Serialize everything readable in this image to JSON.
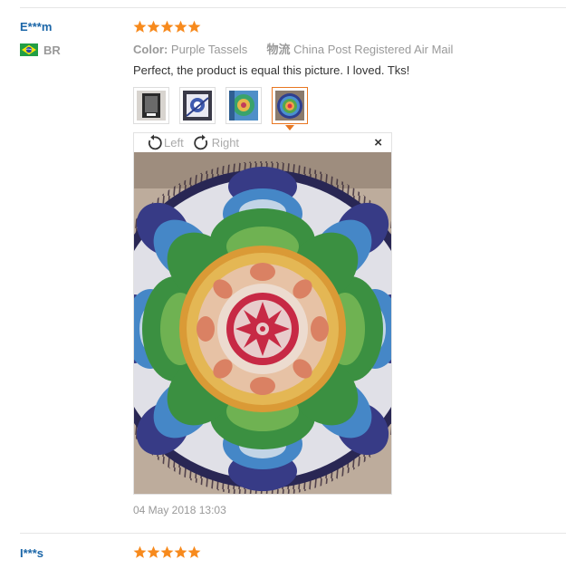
{
  "reviews": [
    {
      "user_name": "E***m",
      "country_code": "BR",
      "rating": 5,
      "color_label": "Color:",
      "color_value": "Purple Tassels",
      "shipping_label": "物流",
      "shipping_value": "China Post Registered Air Mail",
      "text": "Perfect, the product is equal this picture. I loved. Tks!",
      "thumbnail_count": 4,
      "selected_thumbnail": 4,
      "viewer": {
        "rotate_left": "Left",
        "rotate_right": "Right",
        "close": "×"
      },
      "date": "04 May 2018 13:03"
    },
    {
      "user_name": "I***s",
      "rating": 5
    }
  ],
  "colors": {
    "user_name": "#1b66a8",
    "star": "#f78a1d",
    "selected_border": "#e87722",
    "muted_text": "#999999"
  },
  "icons": {
    "star": "star-icon",
    "flag": "brazil-flag-icon",
    "rotate_left": "rotate-left-icon",
    "rotate_right": "rotate-right-icon",
    "close": "close-icon"
  }
}
